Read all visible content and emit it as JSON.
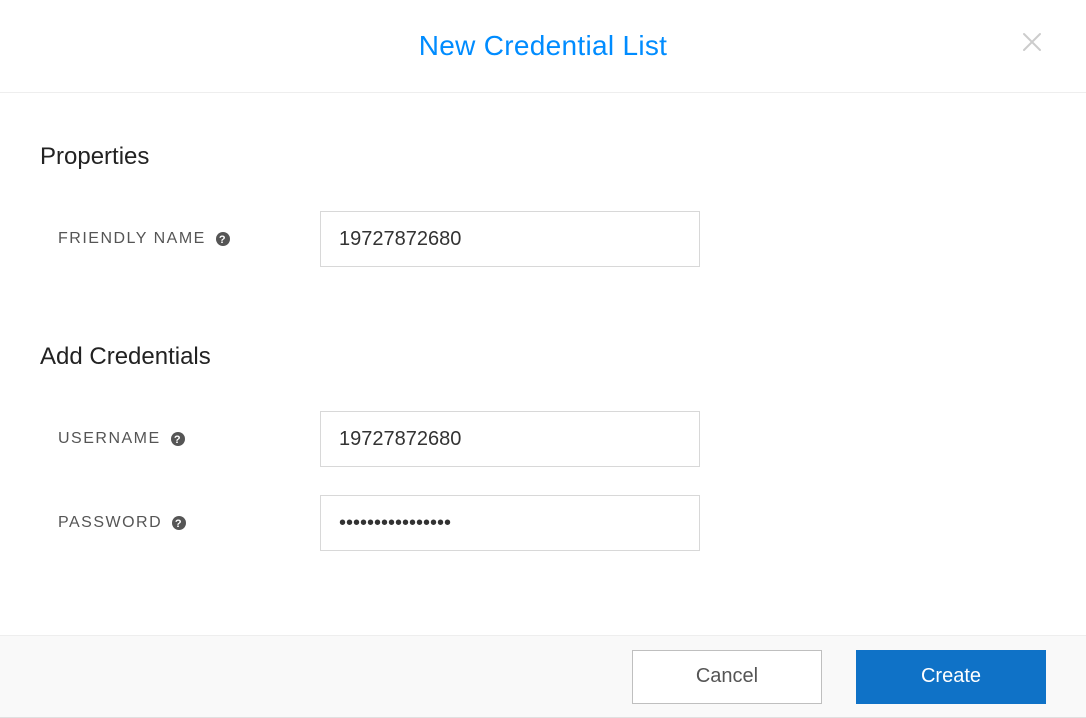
{
  "header": {
    "title": "New Credential List"
  },
  "sections": {
    "properties": {
      "heading": "Properties",
      "friendly_name_label": "FRIENDLY NAME",
      "friendly_name_value": "19727872680"
    },
    "credentials": {
      "heading": "Add Credentials",
      "username_label": "USERNAME",
      "username_value": "19727872680",
      "password_label": "PASSWORD",
      "password_value": "••••••••••••••••"
    }
  },
  "footer": {
    "cancel_label": "Cancel",
    "create_label": "Create"
  }
}
